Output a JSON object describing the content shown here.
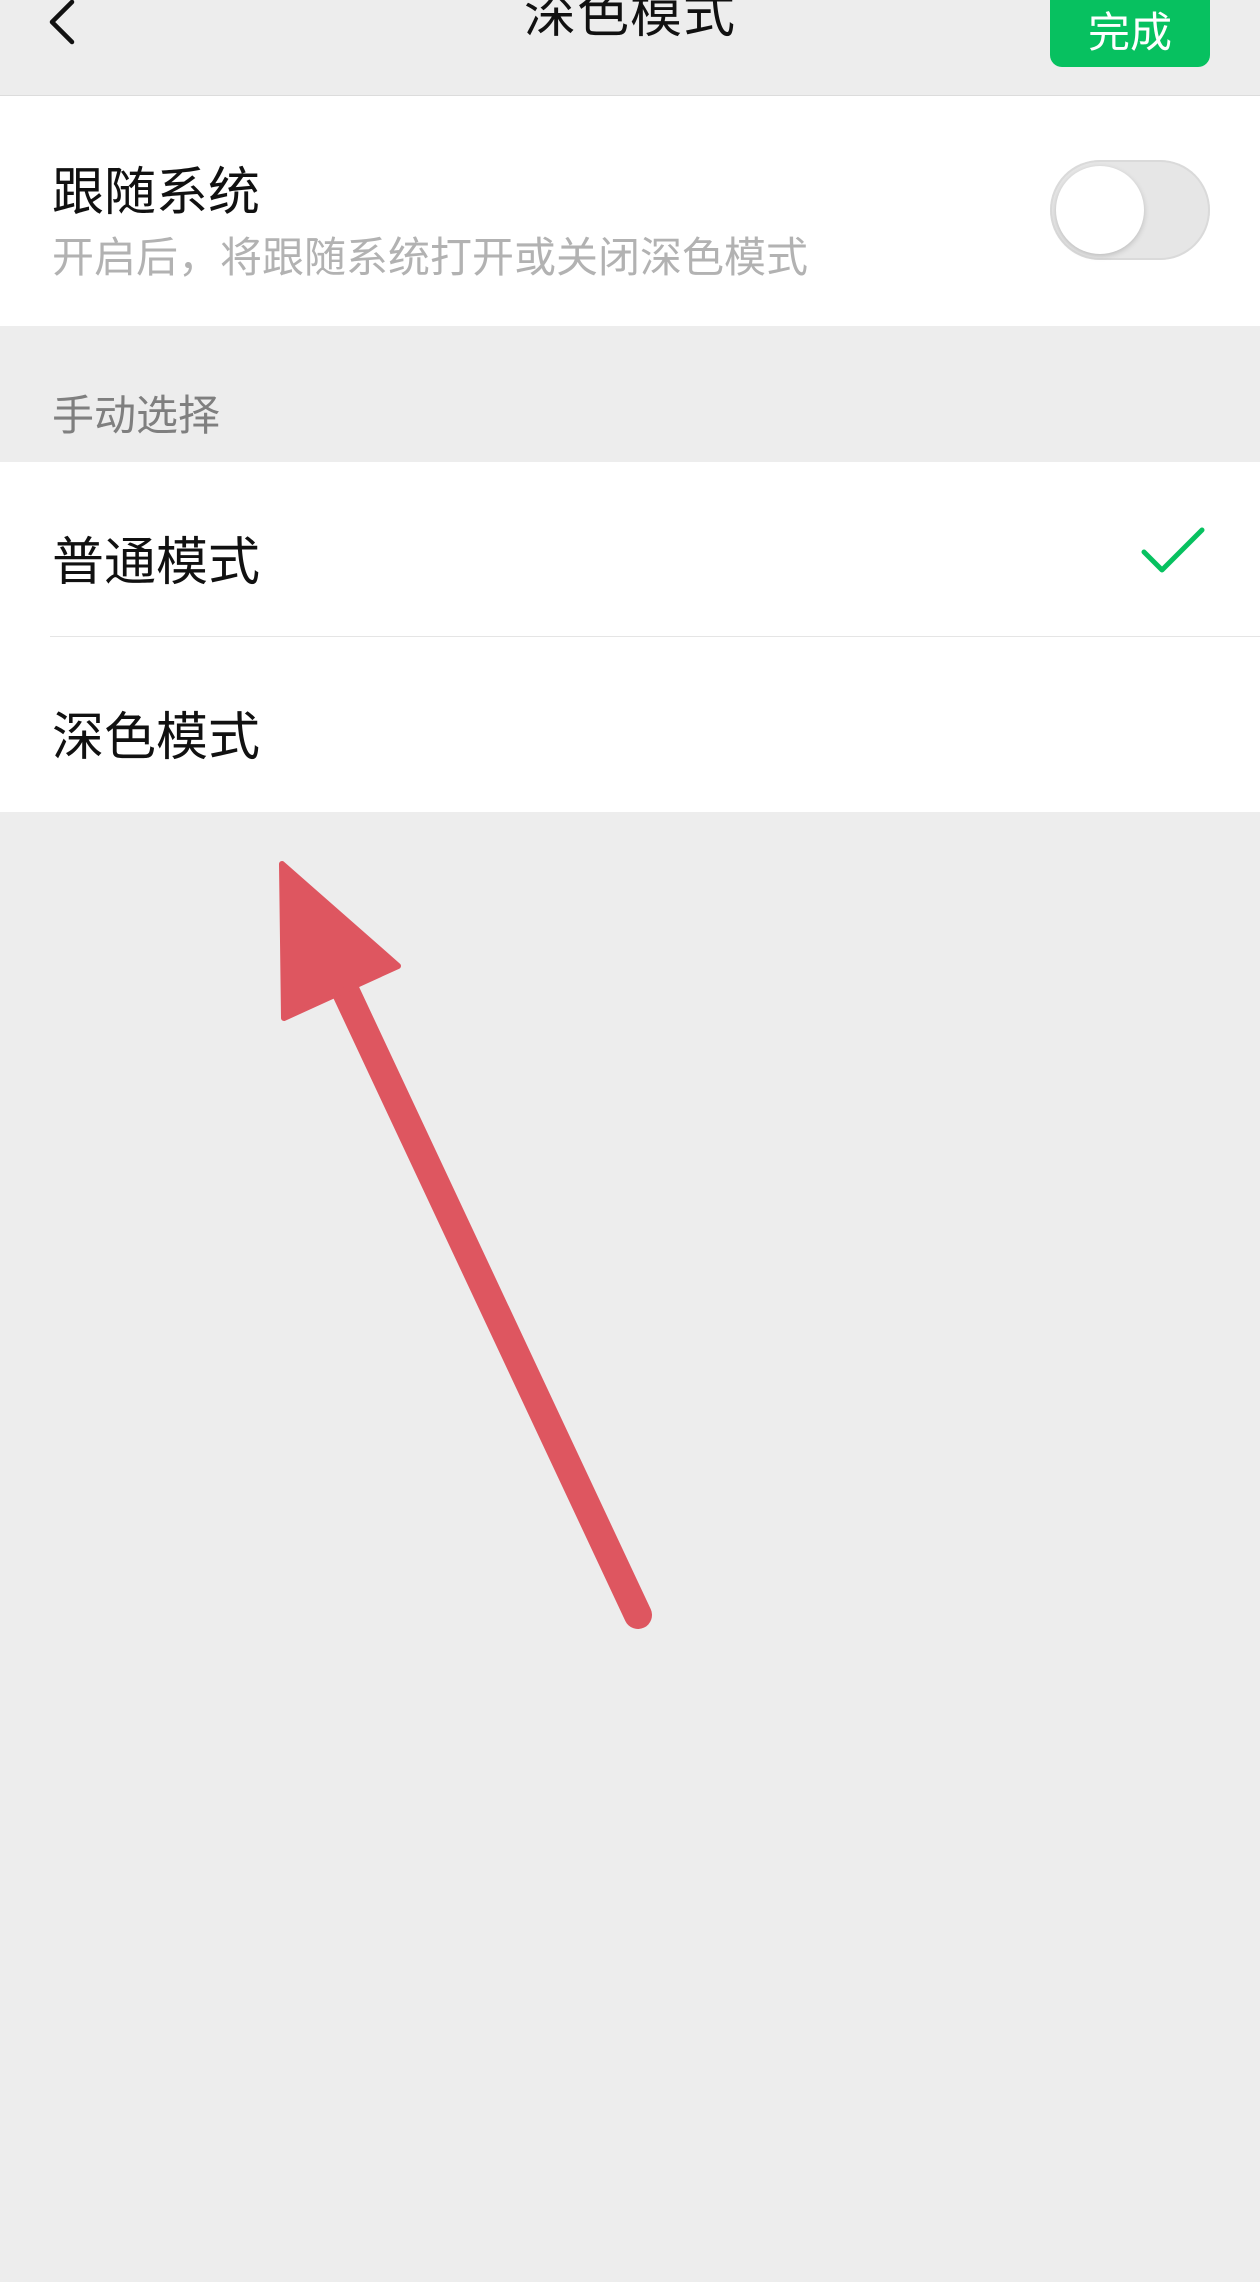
{
  "header": {
    "title": "深色模式",
    "done_label": "完成",
    "back_icon": "chevron-left-icon"
  },
  "follow_system": {
    "title": "跟随系统",
    "subtitle": "开启后，将跟随系统打开或关闭深色模式",
    "enabled": false
  },
  "manual": {
    "section_label": "手动选择",
    "options": [
      {
        "label": "普通模式",
        "selected": true
      },
      {
        "label": "深色模式",
        "selected": false
      }
    ]
  },
  "colors": {
    "accent_green": "#07c160",
    "page_bg": "#ededed",
    "annotation_arrow": "#de5660"
  }
}
